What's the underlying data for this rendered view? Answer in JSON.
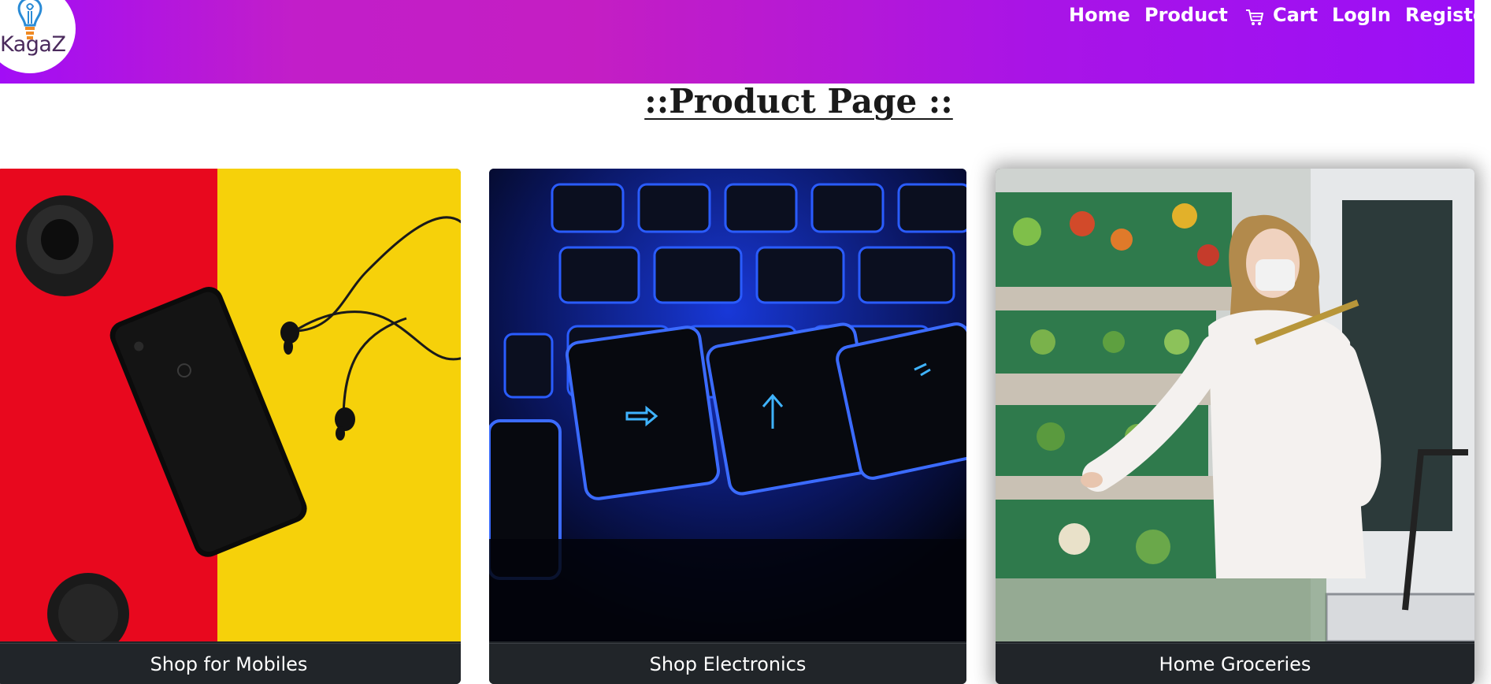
{
  "brand": {
    "name": "KagaZ",
    "icon": "lightbulb-logo-icon"
  },
  "nav": {
    "home": "Home",
    "product": "Product",
    "cart": "Cart",
    "cart_icon": "cart-icon",
    "login": "LogIn",
    "register": "Register"
  },
  "page": {
    "title": "::Product Page ::"
  },
  "cards": [
    {
      "button": "Shop for Mobiles"
    },
    {
      "button": "Shop Electronics"
    },
    {
      "button": "Home Groceries"
    }
  ],
  "colors": {
    "header_gradient_start": "#a20df6",
    "header_gradient_mid": "#c21ec9",
    "button_bg": "#212529",
    "nav_text": "#ffffff"
  }
}
